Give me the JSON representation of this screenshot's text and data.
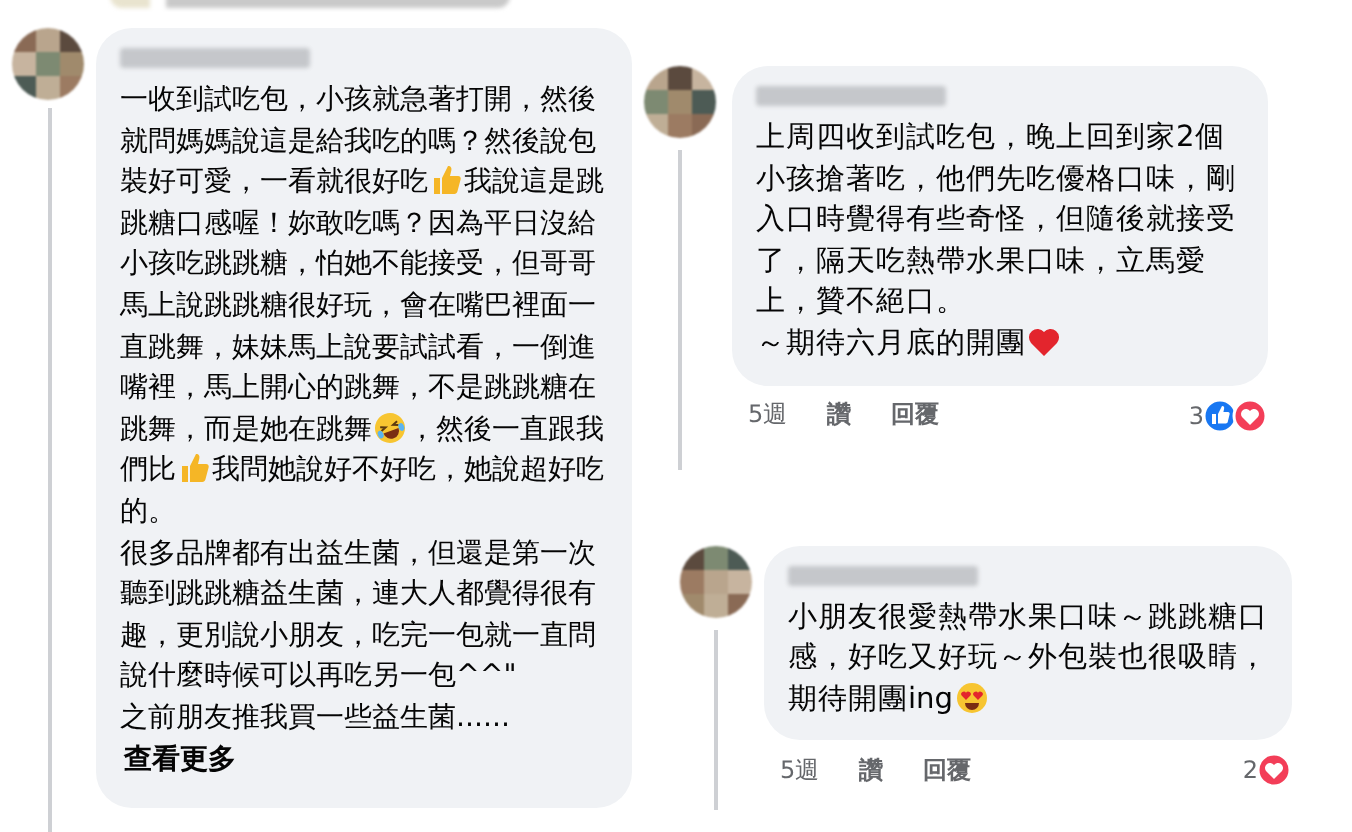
{
  "comments": [
    {
      "paragraphs": [
        [
          {
            "kind": "text",
            "text": "一收到試吃包，小孩就急著打開，然後就問媽媽說這是給我吃的嗎？然後說包裝好可愛，一看就很好吃"
          },
          {
            "kind": "thumbs-up"
          },
          {
            "kind": "text",
            "text": "我說這是跳跳糖口感喔！妳敢吃嗎？因為平日沒給小孩吃跳跳糖，怕她不能接受，但哥哥馬上說跳跳糖很好玩，會在嘴巴裡面一直跳舞，妹妹馬上說要試試看，一倒進嘴裡，馬上開心的跳舞，不是跳跳糖在跳舞，而是她在跳舞"
          },
          {
            "kind": "laughing"
          },
          {
            "kind": "text",
            "text": "，然後一直跟我們比"
          },
          {
            "kind": "thumbs-up"
          },
          {
            "kind": "text",
            "text": "我問她說好不好吃，她說超好吃的。"
          }
        ],
        [
          {
            "kind": "text",
            "text": "很多品牌都有出益生菌，但還是第一次聽到跳跳糖益生菌，連大人都覺得很有趣，更別說小朋友，吃完一包就一直問說什麼時候可以再吃另一包^^\""
          }
        ],
        [
          {
            "kind": "text",
            "text": "之前朋友推我買一些益生菌......"
          }
        ]
      ],
      "see_more": "查看更多"
    },
    {
      "paragraphs": [
        [
          {
            "kind": "text",
            "text": "上周四收到試吃包，晚上回到家2個小孩搶著吃，他們先吃優格口味，剛入口時覺得有些奇怪，但隨後就接受了，隔天吃熱帶水果口味，立馬愛上，贊不絕口。"
          }
        ],
        [
          {
            "kind": "text",
            "text": "～期待六月底的開團"
          },
          {
            "kind": "heart"
          }
        ]
      ],
      "time": "5週",
      "like": "讚",
      "reply": "回覆",
      "reaction_count": "3",
      "reactions": [
        {
          "kind": "like"
        },
        {
          "kind": "love"
        }
      ]
    },
    {
      "paragraphs": [
        [
          {
            "kind": "text",
            "text": "小朋友很愛熱帶水果口味～跳跳糖口感，好吃又好玩～外包裝也很吸睛，期待開團ing"
          },
          {
            "kind": "heart-eyes"
          }
        ]
      ],
      "time": "5週",
      "like": "讚",
      "reply": "回覆",
      "reaction_count": "2",
      "reactions": [
        {
          "kind": "love"
        }
      ]
    }
  ]
}
